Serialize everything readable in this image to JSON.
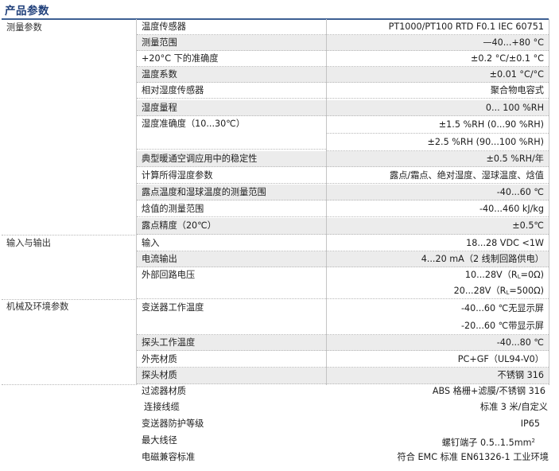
{
  "title": "产品参数",
  "categories": {
    "measurement": "测量参数",
    "io": "输入与输出",
    "mechanical": "机械及环境参数"
  },
  "rows": [
    {
      "label": "温度传感器",
      "value": "PT1000/PT100 RTD F0.1 IEC 60751"
    },
    {
      "label": "测量范围",
      "value": "—40...+80 °C"
    },
    {
      "label": "+20°C 下的准确度",
      "value": "±0.2 °C/±0.1 °C"
    },
    {
      "label": "温度系数",
      "value": "±0.01 °C/°C"
    },
    {
      "label": "相对湿度传感器",
      "value": "聚合物电容式"
    },
    {
      "label": "湿度量程",
      "value": "0... 100 %RH"
    },
    {
      "label": "湿度准确度（10...30℃）",
      "value": "±1.5 %RH (0...90 %RH)"
    },
    {
      "label": "",
      "value": "±2.5 %RH (90...100 %RH)"
    },
    {
      "label": "典型暖通空调应用中的稳定性",
      "value": "±0.5 %RH/年"
    },
    {
      "label": "计算所得湿度参数",
      "value": "露点/霜点、绝对湿度、湿球温度、焓值"
    },
    {
      "label": "露点温度和湿球温度的测量范围",
      "value": "-40...60 ℃"
    },
    {
      "label": "焓值的测量范围",
      "value": "-40...460 kJ/kg"
    },
    {
      "label": "露点精度（20℃）",
      "value": "±0.5℃"
    },
    {
      "label": "输入",
      "value": "18...28 VDC <1W"
    },
    {
      "label": "电流输出",
      "value": "4...20 mA（2 线制回路供电）"
    },
    {
      "label": "外部回路电压",
      "value": "10...28V（R",
      "value_sub": "L",
      "value_end": "=0Ω)"
    },
    {
      "label": "",
      "value": "20...28V（R",
      "value_sub": "L",
      "value_end": "=500Ω)"
    },
    {
      "label": "变送器工作温度",
      "value": "-40...60 ℃无显示屏"
    },
    {
      "label": "",
      "value": "-20...60 ℃带显示屏"
    },
    {
      "label": "探头工作温度",
      "value": "-40...80 ℃"
    },
    {
      "label": "外壳材质",
      "value": "PC+GF（UL94-V0）"
    },
    {
      "label": "探头材质",
      "value": "不锈钢 316"
    }
  ],
  "extra_rows": [
    {
      "label": "过滤器材质",
      "value": "ABS 格栅+滤膜/不锈钢 316"
    },
    {
      "label": "连接线缆",
      "value": "标准 3 米/自定义"
    },
    {
      "label": "变送器防护等级",
      "value": "IP65"
    },
    {
      "label": "最大线径",
      "value": "螺钉端子 0.5..1.5mm",
      "value_sup": "2"
    },
    {
      "label": "电磁兼容标准",
      "value": "符合 EMC 标准 EN61326-1 工业环境"
    }
  ]
}
